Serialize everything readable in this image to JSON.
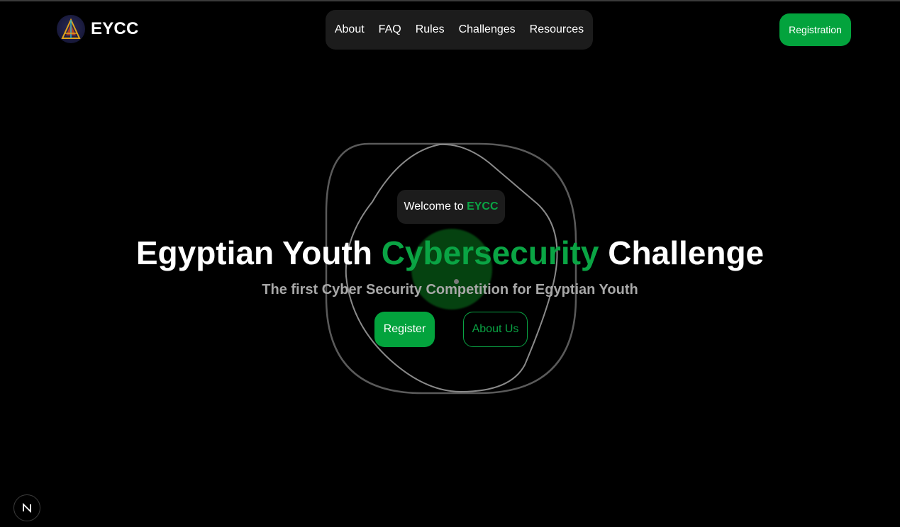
{
  "brand": {
    "name": "EYCC",
    "logo_icon": "pyramid-logo-icon"
  },
  "nav": {
    "items": [
      {
        "label": "About"
      },
      {
        "label": "FAQ"
      },
      {
        "label": "Rules"
      },
      {
        "label": "Challenges"
      },
      {
        "label": "Resources"
      }
    ],
    "registration_label": "Registration"
  },
  "hero": {
    "welcome_prefix": "Welcome to ",
    "welcome_brand": "EYCC",
    "title_part1": "Egyptian Youth ",
    "title_accent": "Cybersecurity",
    "title_part2": " Challenge",
    "subtitle": "The first Cyber Security Competition for Egyptian Youth",
    "register_label": "Register",
    "about_label": "About Us"
  },
  "dev_badge": {
    "letter": "N"
  },
  "colors": {
    "accent": "#03a33d",
    "accent_text": "#0aa444",
    "background": "#000000",
    "panel": "#1c1c1c"
  }
}
